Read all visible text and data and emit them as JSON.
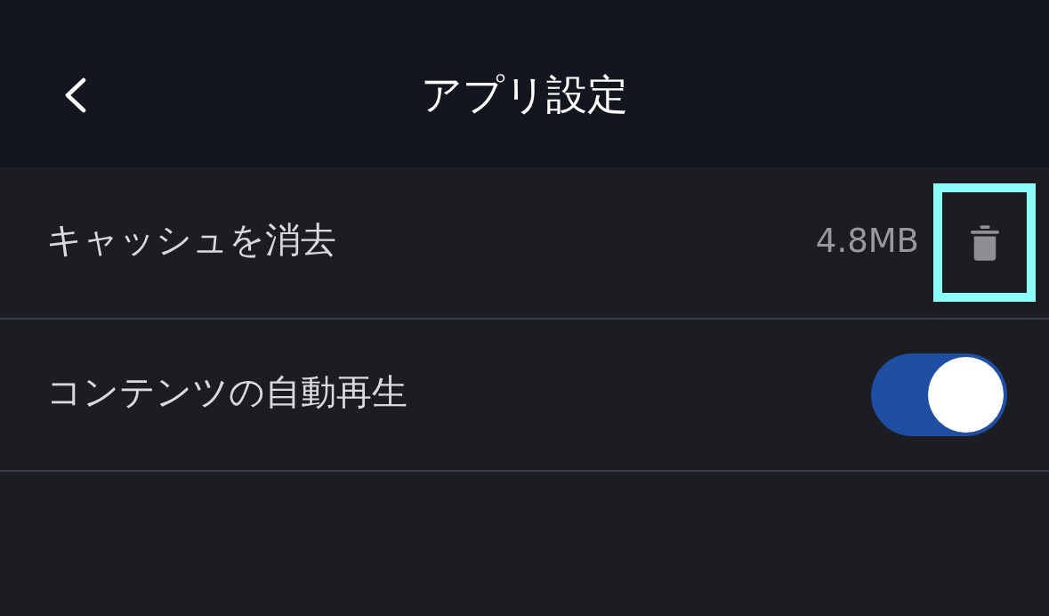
{
  "header": {
    "title": "アプリ設定"
  },
  "settings": [
    {
      "kind": "action",
      "label": "キャッシュを消去",
      "value": "4.8MB",
      "highlighted": true
    },
    {
      "kind": "toggle",
      "label": "コンテンツの自動再生",
      "on": true
    }
  ]
}
